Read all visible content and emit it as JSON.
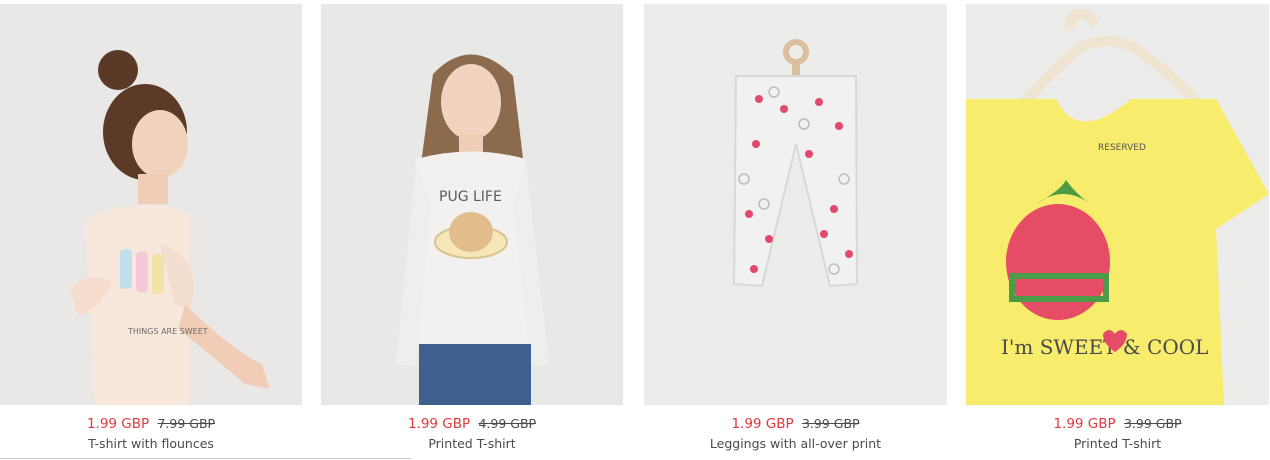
{
  "products": [
    {
      "sale_price": "1.99 GBP",
      "old_price": "7.99 GBP",
      "title": "T-shirt with flounces",
      "image_icon": "girl-flounce-tshirt",
      "print_text": "THINGS ARE SWEET"
    },
    {
      "sale_price": "1.99 GBP",
      "old_price": "4.99 GBP",
      "title": "Printed T-shirt",
      "image_icon": "girl-pug-tshirt",
      "print_text": "PUG LIFE"
    },
    {
      "sale_price": "1.99 GBP",
      "old_price": "3.99 GBP",
      "title": "Leggings with all-over print",
      "image_icon": "crab-print-leggings",
      "print_text": ""
    },
    {
      "sale_price": "1.99 GBP",
      "old_price": "3.99 GBP",
      "title": "Printed T-shirt",
      "image_icon": "strawberry-tshirt",
      "print_text": "I'm SWEET & COOL",
      "label_text": "RESERVED"
    }
  ],
  "colors": {
    "sale": "#e0393e",
    "text": "#4a4a4a",
    "bg_photo": "#ececea",
    "yellow": "#f8ee6a"
  }
}
